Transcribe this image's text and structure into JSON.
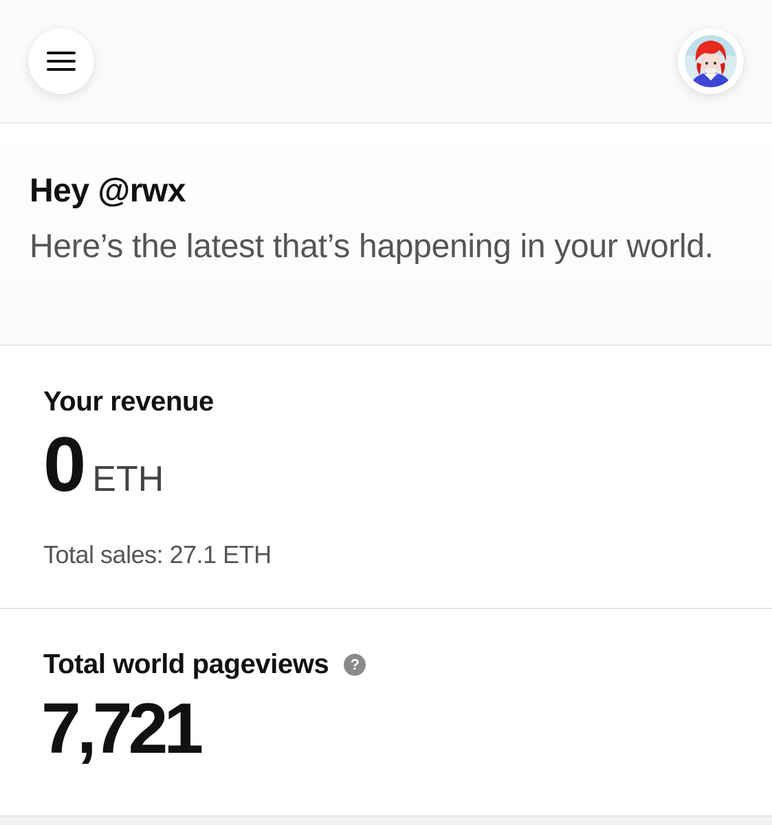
{
  "header": {
    "menu_icon": "hamburger-menu-icon",
    "avatar_icon": "user-avatar-icon"
  },
  "greeting": {
    "title": "Hey @rwx",
    "subtitle": "Here’s the latest that’s happening in your world."
  },
  "revenue": {
    "title": "Your revenue",
    "value": "0",
    "unit": "ETH",
    "total_sales": "Total sales: 27.1 ETH"
  },
  "pageviews": {
    "title": "Total world pageviews",
    "help_glyph": "?",
    "value": "7,721"
  },
  "colors": {
    "text_primary": "#111111",
    "text_secondary": "#555555",
    "help_icon_bg": "#8a8a8a"
  }
}
